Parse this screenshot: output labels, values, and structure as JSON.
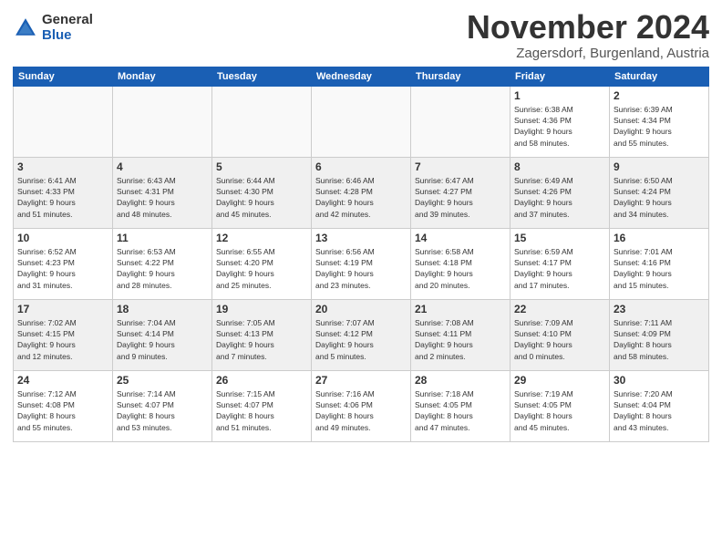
{
  "logo": {
    "general": "General",
    "blue": "Blue"
  },
  "title": "November 2024",
  "location": "Zagersdorf, Burgenland, Austria",
  "days_of_week": [
    "Sunday",
    "Monday",
    "Tuesday",
    "Wednesday",
    "Thursday",
    "Friday",
    "Saturday"
  ],
  "weeks": [
    [
      {
        "day": "",
        "info": ""
      },
      {
        "day": "",
        "info": ""
      },
      {
        "day": "",
        "info": ""
      },
      {
        "day": "",
        "info": ""
      },
      {
        "day": "",
        "info": ""
      },
      {
        "day": "1",
        "info": "Sunrise: 6:38 AM\nSunset: 4:36 PM\nDaylight: 9 hours\nand 58 minutes."
      },
      {
        "day": "2",
        "info": "Sunrise: 6:39 AM\nSunset: 4:34 PM\nDaylight: 9 hours\nand 55 minutes."
      }
    ],
    [
      {
        "day": "3",
        "info": "Sunrise: 6:41 AM\nSunset: 4:33 PM\nDaylight: 9 hours\nand 51 minutes."
      },
      {
        "day": "4",
        "info": "Sunrise: 6:43 AM\nSunset: 4:31 PM\nDaylight: 9 hours\nand 48 minutes."
      },
      {
        "day": "5",
        "info": "Sunrise: 6:44 AM\nSunset: 4:30 PM\nDaylight: 9 hours\nand 45 minutes."
      },
      {
        "day": "6",
        "info": "Sunrise: 6:46 AM\nSunset: 4:28 PM\nDaylight: 9 hours\nand 42 minutes."
      },
      {
        "day": "7",
        "info": "Sunrise: 6:47 AM\nSunset: 4:27 PM\nDaylight: 9 hours\nand 39 minutes."
      },
      {
        "day": "8",
        "info": "Sunrise: 6:49 AM\nSunset: 4:26 PM\nDaylight: 9 hours\nand 37 minutes."
      },
      {
        "day": "9",
        "info": "Sunrise: 6:50 AM\nSunset: 4:24 PM\nDaylight: 9 hours\nand 34 minutes."
      }
    ],
    [
      {
        "day": "10",
        "info": "Sunrise: 6:52 AM\nSunset: 4:23 PM\nDaylight: 9 hours\nand 31 minutes."
      },
      {
        "day": "11",
        "info": "Sunrise: 6:53 AM\nSunset: 4:22 PM\nDaylight: 9 hours\nand 28 minutes."
      },
      {
        "day": "12",
        "info": "Sunrise: 6:55 AM\nSunset: 4:20 PM\nDaylight: 9 hours\nand 25 minutes."
      },
      {
        "day": "13",
        "info": "Sunrise: 6:56 AM\nSunset: 4:19 PM\nDaylight: 9 hours\nand 23 minutes."
      },
      {
        "day": "14",
        "info": "Sunrise: 6:58 AM\nSunset: 4:18 PM\nDaylight: 9 hours\nand 20 minutes."
      },
      {
        "day": "15",
        "info": "Sunrise: 6:59 AM\nSunset: 4:17 PM\nDaylight: 9 hours\nand 17 minutes."
      },
      {
        "day": "16",
        "info": "Sunrise: 7:01 AM\nSunset: 4:16 PM\nDaylight: 9 hours\nand 15 minutes."
      }
    ],
    [
      {
        "day": "17",
        "info": "Sunrise: 7:02 AM\nSunset: 4:15 PM\nDaylight: 9 hours\nand 12 minutes."
      },
      {
        "day": "18",
        "info": "Sunrise: 7:04 AM\nSunset: 4:14 PM\nDaylight: 9 hours\nand 9 minutes."
      },
      {
        "day": "19",
        "info": "Sunrise: 7:05 AM\nSunset: 4:13 PM\nDaylight: 9 hours\nand 7 minutes."
      },
      {
        "day": "20",
        "info": "Sunrise: 7:07 AM\nSunset: 4:12 PM\nDaylight: 9 hours\nand 5 minutes."
      },
      {
        "day": "21",
        "info": "Sunrise: 7:08 AM\nSunset: 4:11 PM\nDaylight: 9 hours\nand 2 minutes."
      },
      {
        "day": "22",
        "info": "Sunrise: 7:09 AM\nSunset: 4:10 PM\nDaylight: 9 hours\nand 0 minutes."
      },
      {
        "day": "23",
        "info": "Sunrise: 7:11 AM\nSunset: 4:09 PM\nDaylight: 8 hours\nand 58 minutes."
      }
    ],
    [
      {
        "day": "24",
        "info": "Sunrise: 7:12 AM\nSunset: 4:08 PM\nDaylight: 8 hours\nand 55 minutes."
      },
      {
        "day": "25",
        "info": "Sunrise: 7:14 AM\nSunset: 4:07 PM\nDaylight: 8 hours\nand 53 minutes."
      },
      {
        "day": "26",
        "info": "Sunrise: 7:15 AM\nSunset: 4:07 PM\nDaylight: 8 hours\nand 51 minutes."
      },
      {
        "day": "27",
        "info": "Sunrise: 7:16 AM\nSunset: 4:06 PM\nDaylight: 8 hours\nand 49 minutes."
      },
      {
        "day": "28",
        "info": "Sunrise: 7:18 AM\nSunset: 4:05 PM\nDaylight: 8 hours\nand 47 minutes."
      },
      {
        "day": "29",
        "info": "Sunrise: 7:19 AM\nSunset: 4:05 PM\nDaylight: 8 hours\nand 45 minutes."
      },
      {
        "day": "30",
        "info": "Sunrise: 7:20 AM\nSunset: 4:04 PM\nDaylight: 8 hours\nand 43 minutes."
      }
    ]
  ]
}
